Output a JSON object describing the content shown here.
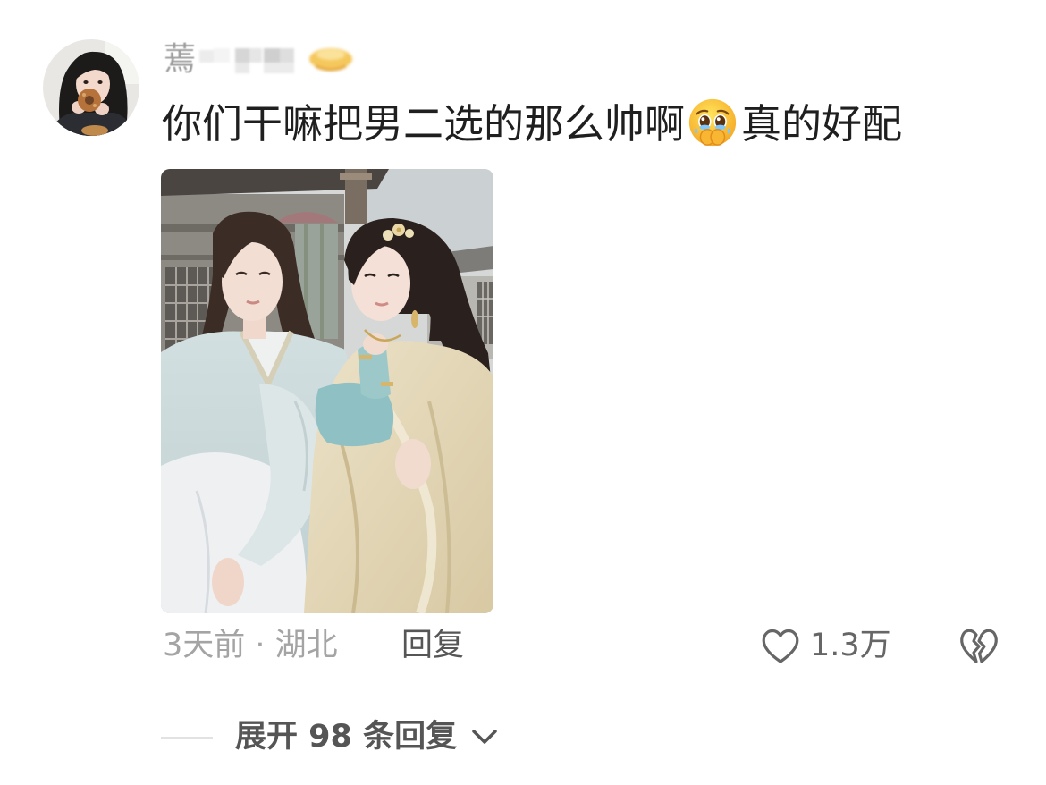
{
  "comment": {
    "username_visible": "蔫",
    "username_badge_icon": "blurred-emoji-icon",
    "text_part1": "你们干嘛把男二选的那么帅啊",
    "inline_emoji": "face-holding-back-tears-emoji",
    "text_part2": "真的好配",
    "meta": "3天前 · 湖北",
    "reply_label": "回复",
    "like_icon": "heart-outline-icon",
    "like_count": "1.3万",
    "dislike_icon": "broken-heart-icon"
  },
  "replies": {
    "expand_label": "展开 98 条回复",
    "expand_icon": "chevron-down-icon"
  },
  "colors": {
    "background": "#ffffff",
    "text_primary": "#1f1f1f",
    "text_secondary": "#a4a4a4",
    "text_action": "#565656",
    "icon": "#666666",
    "divider": "#e2e2e2"
  }
}
